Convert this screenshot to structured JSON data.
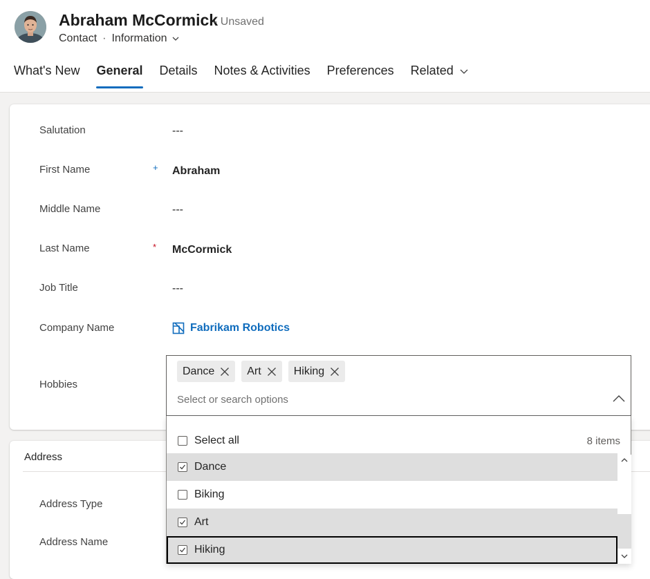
{
  "header": {
    "title": "Abraham McCormick",
    "status": "- Unsaved",
    "entity": "Contact",
    "separator": "·",
    "form_name": "Information",
    "avatar_icon": "person-photo-avatar"
  },
  "tabs": [
    {
      "label": "What's New",
      "active": false
    },
    {
      "label": "General",
      "active": true
    },
    {
      "label": "Details",
      "active": false
    },
    {
      "label": "Notes & Activities",
      "active": false
    },
    {
      "label": "Preferences",
      "active": false
    },
    {
      "label": "Related",
      "active": false
    }
  ],
  "form": {
    "salutation": {
      "label": "Salutation",
      "value": "---"
    },
    "first_name": {
      "label": "First Name",
      "value": "Abraham",
      "required_marker": "+"
    },
    "middle_name": {
      "label": "Middle Name",
      "value": "---"
    },
    "last_name": {
      "label": "Last Name",
      "value": "McCormick",
      "required_marker": "*"
    },
    "job_title": {
      "label": "Job Title",
      "value": "---"
    },
    "company_name": {
      "label": "Company Name",
      "value": "Fabrikam Robotics",
      "icon": "account-record-icon"
    },
    "hobbies": {
      "label": "Hobbies",
      "selected": [
        "Dance",
        "Art",
        "Hiking"
      ],
      "placeholder": "Select or search options"
    }
  },
  "dropdown": {
    "select_all": "Select all",
    "count": "8 items",
    "options": [
      {
        "label": "Dance",
        "checked": true
      },
      {
        "label": "Biking",
        "checked": false
      },
      {
        "label": "Art",
        "checked": true
      },
      {
        "label": "Hiking",
        "checked": true
      }
    ]
  },
  "address": {
    "section_title": "Address",
    "address_type": "Address Type",
    "address_name": "Address Name"
  },
  "colors": {
    "accent": "#0f6cbd",
    "required_red": "#c50f1f",
    "selected_row": "#dedede"
  }
}
